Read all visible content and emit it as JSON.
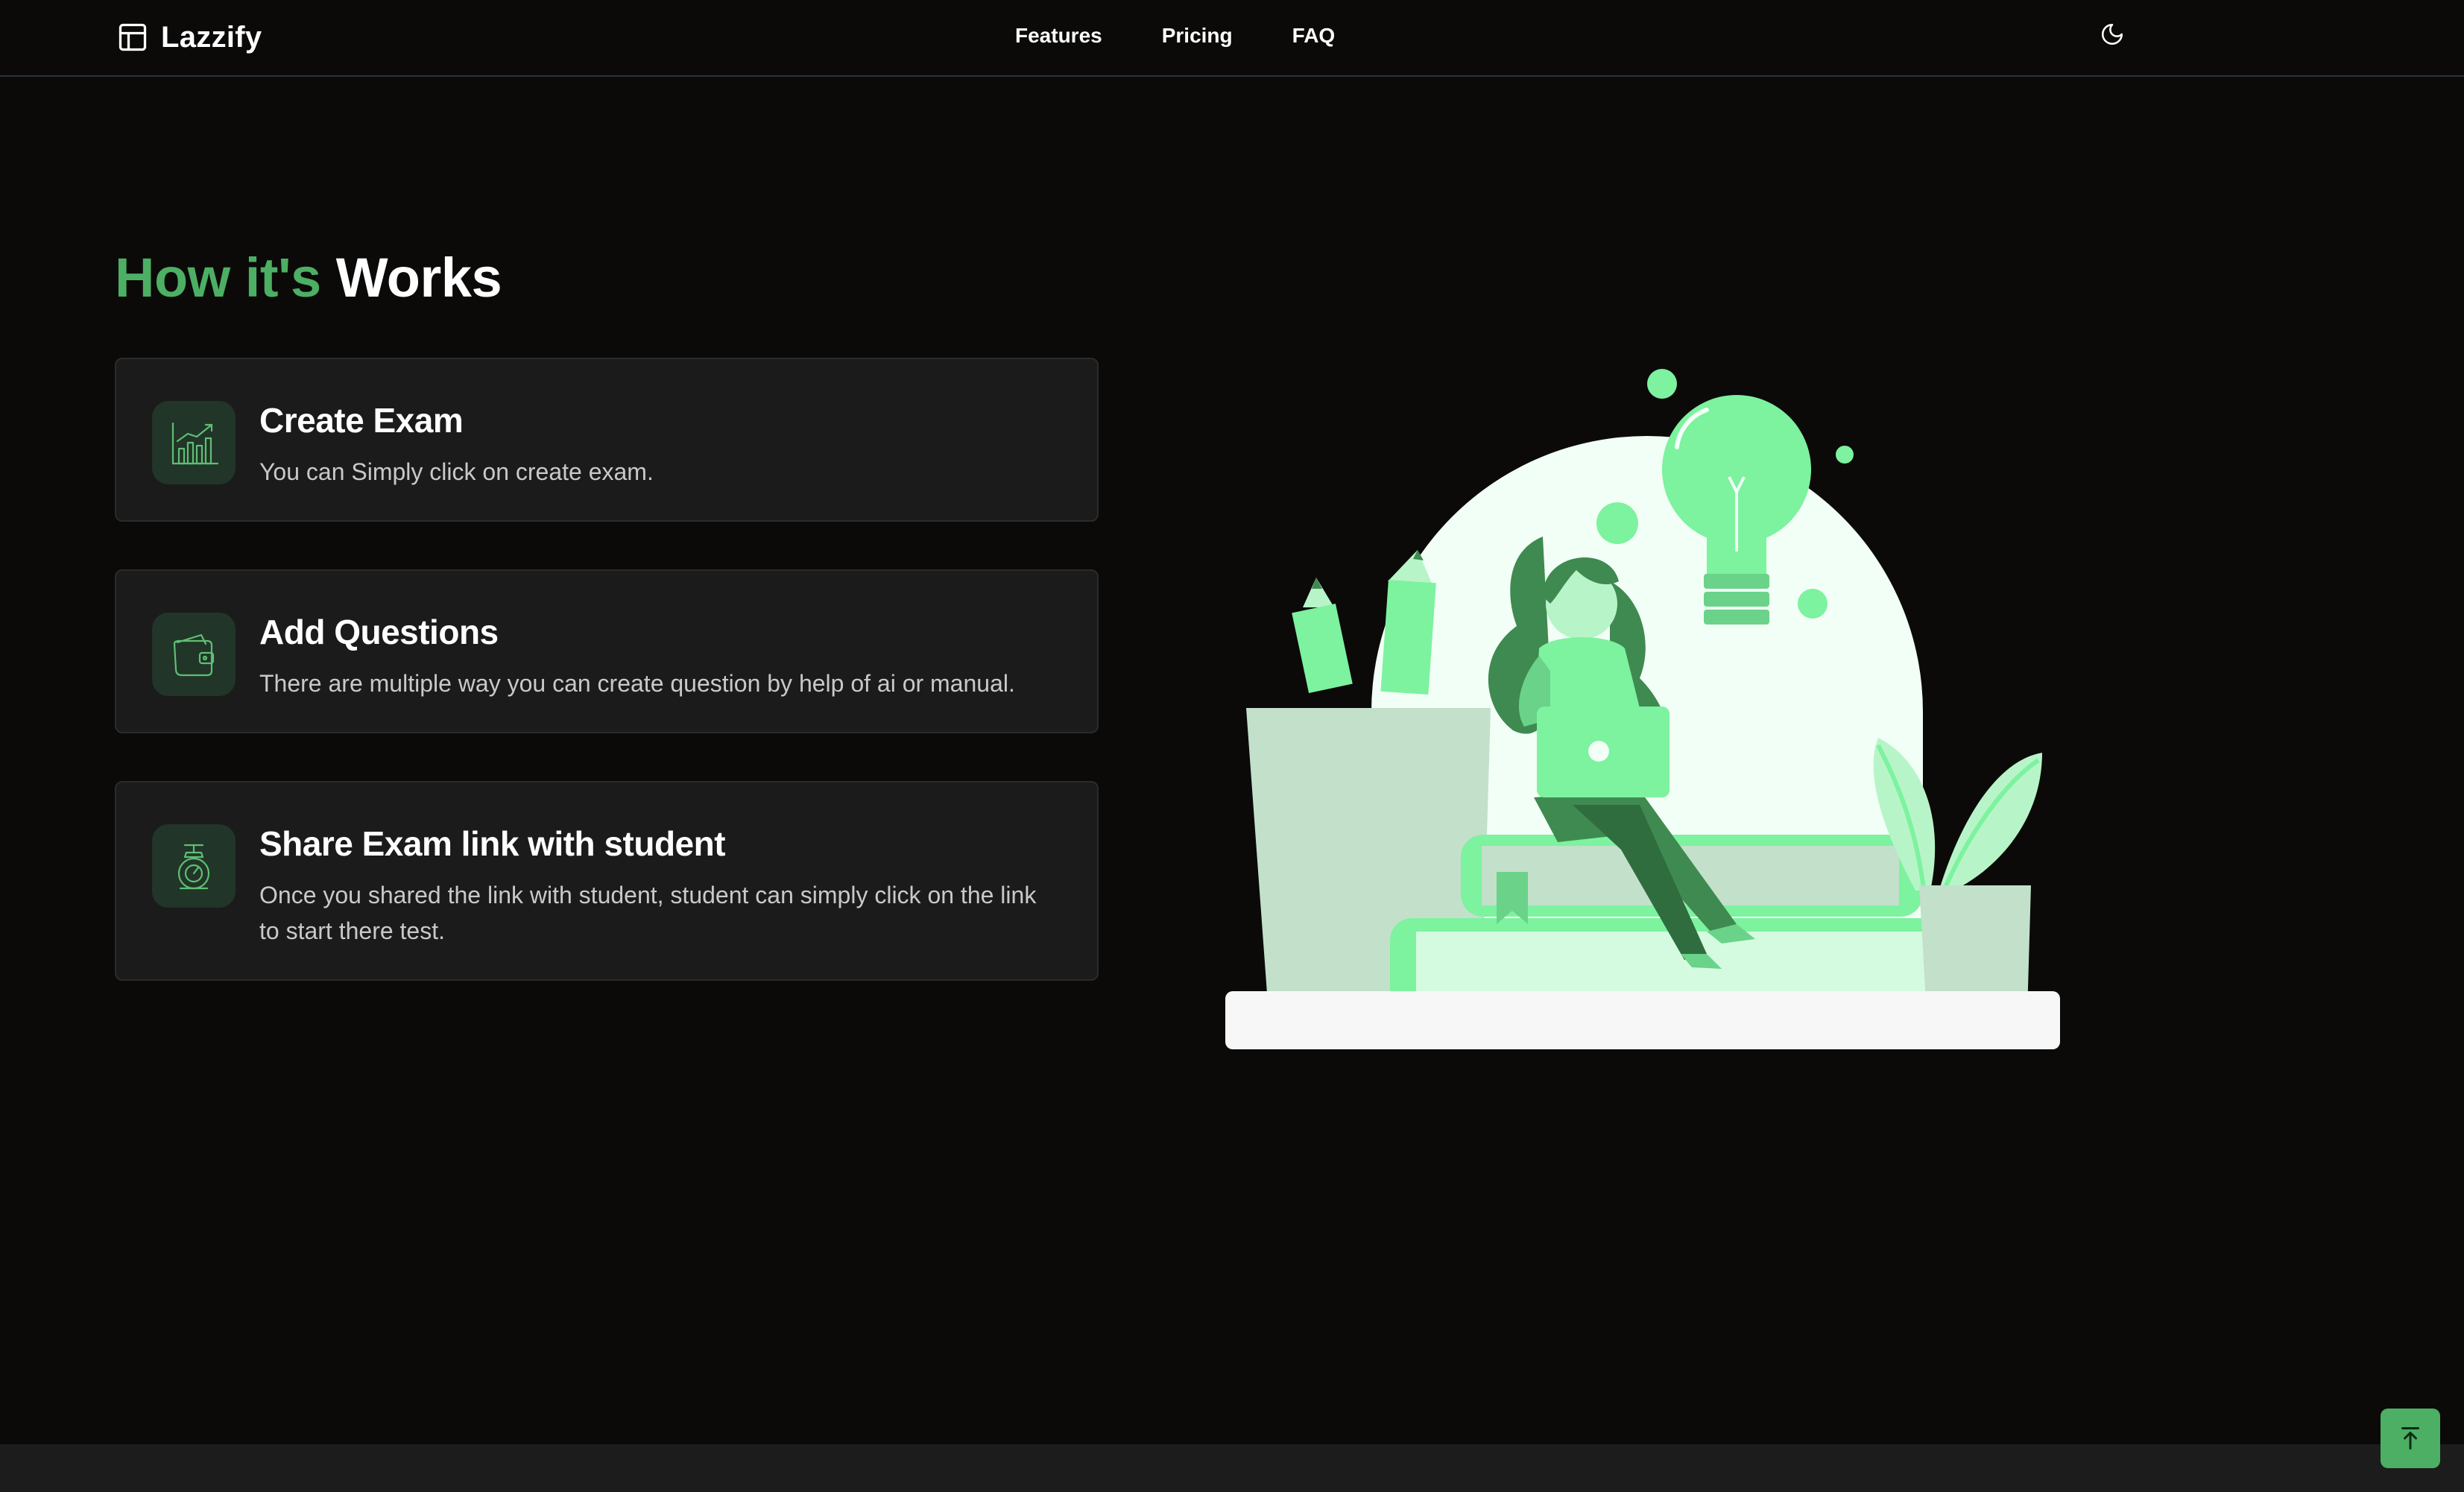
{
  "header": {
    "brand": "Lazzify",
    "brand_icon": "layout-icon",
    "nav": [
      "Features",
      "Pricing",
      "FAQ"
    ],
    "theme_icon": "moon-icon"
  },
  "section": {
    "title_accent": "How it's",
    "title_main": "Works",
    "accent_color": "#4caf63"
  },
  "steps": [
    {
      "icon": "growth-chart-icon",
      "title": "Create Exam",
      "description": "You can Simply click on create exam."
    },
    {
      "icon": "wallet-icon",
      "title": "Add Questions",
      "description": "There are multiple way you can create question by help of ai or manual."
    },
    {
      "icon": "scale-icon",
      "title": "Share Exam link with student",
      "description": "Once you shared the link with student, student can simply click on the link to start there test."
    }
  ],
  "illustration": {
    "name": "woman-reading-on-books-illustration"
  },
  "scroll_top": {
    "icon": "arrow-up-to-line-icon"
  }
}
